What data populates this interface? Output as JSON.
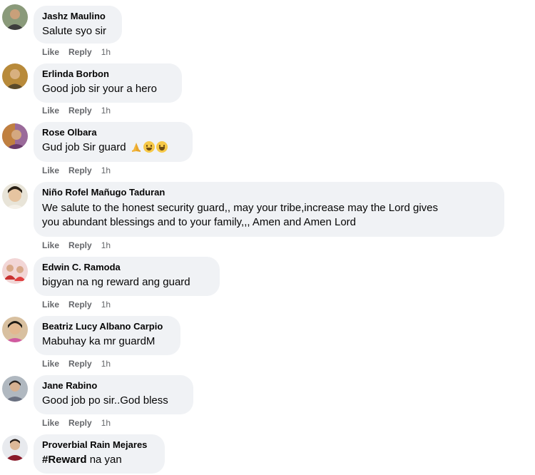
{
  "actions": {
    "like": "Like",
    "reply": "Reply"
  },
  "comments": [
    {
      "author": "Jashz Maulino",
      "text": "Salute syo sir",
      "time": "1h"
    },
    {
      "author": "Erlinda Borbon",
      "text": "Good job sir your a hero",
      "time": "1h"
    },
    {
      "author": "Rose Olbara",
      "text": "Gud job Sir guard",
      "time": "1h",
      "emojis": [
        "folded-hands",
        "smiling-face",
        "laughing-face"
      ]
    },
    {
      "author": "Niño Rofel Mañugo Taduran",
      "text_line1": "We salute to the honest security guard,, may your tribe,increase may the Lord gives",
      "text_line2": "you abundant blessings and to your family,,, Amen and Amen Lord",
      "time": "1h"
    },
    {
      "author": "Edwin C. Ramoda",
      "text": "bigyan na ng reward ang guard",
      "time": "1h"
    },
    {
      "author": "Beatriz Lucy Albano Carpio",
      "text": "Mabuhay ka mr guardM",
      "time": "1h"
    },
    {
      "author": "Jane Rabino",
      "text": "Good job po sir..God bless",
      "time": "1h"
    },
    {
      "author": "Proverbial Rain Mejares",
      "text_hashtag": "#Reward",
      "text_rest": " na yan"
    }
  ],
  "colors": {
    "bubble": "#f0f2f5",
    "meta": "#65676b",
    "text": "#050505"
  }
}
